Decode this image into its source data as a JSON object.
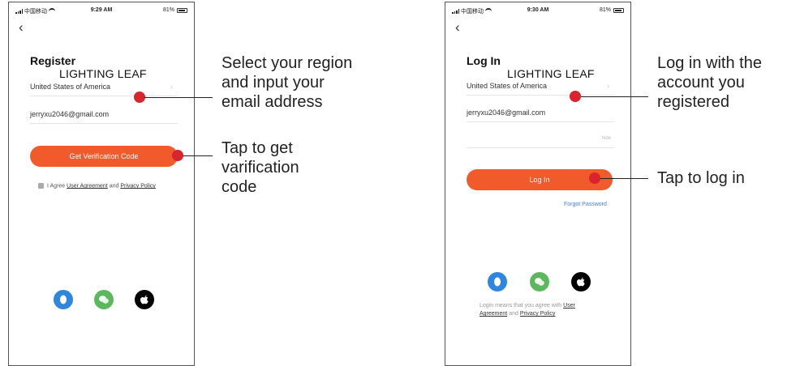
{
  "register_screen": {
    "status": {
      "carrier": "中国移动",
      "time": "9:29 AM",
      "battery": "81%"
    },
    "back_glyph": "‹",
    "title": "Register",
    "brand": "LIGHTING LEAF",
    "region": "United States of America",
    "region_chevron": "›",
    "email": "jerryxu2046@gmail.com",
    "button_label": "Get Verification Code",
    "agree_prefix": "I Agree",
    "agree_user_agreement": "User Agreement",
    "agree_and": "and",
    "agree_privacy": "Privacy Policy",
    "social_icons": [
      "qq-icon",
      "wechat-icon",
      "apple-icon"
    ]
  },
  "login_screen": {
    "status": {
      "carrier": "中国移动",
      "time": "9:30 AM",
      "battery": "81%"
    },
    "back_glyph": "‹",
    "title": "Log In",
    "brand": "LIGHTING LEAF",
    "region": "United States of America",
    "region_chevron": "›",
    "email": "jerryxu2046@gmail.com",
    "password_icon": "hide",
    "button_label": "Log In",
    "forgot": "Forgot Password",
    "legal_prefix": "Login means that you agree with",
    "legal_user_agreement_1": "User",
    "legal_user_agreement_2": "Agreement",
    "legal_and": "and",
    "legal_privacy": "Privacy Policy",
    "social_icons": [
      "qq-icon",
      "wechat-icon",
      "apple-icon"
    ]
  },
  "callouts": {
    "region": [
      "Select your region",
      "and input your",
      "email address"
    ],
    "verification": [
      "Tap to get",
      "varification",
      "code"
    ],
    "login_account": [
      "Log in with the",
      "account you",
      "registered"
    ],
    "tap_login": "Tap to log in"
  },
  "colors": {
    "button": "#f15a2b",
    "marker": "#d9232d",
    "qq": "#2e86de",
    "wechat": "#5cb85c",
    "apple": "#000000",
    "link": "#4a7dc9"
  }
}
